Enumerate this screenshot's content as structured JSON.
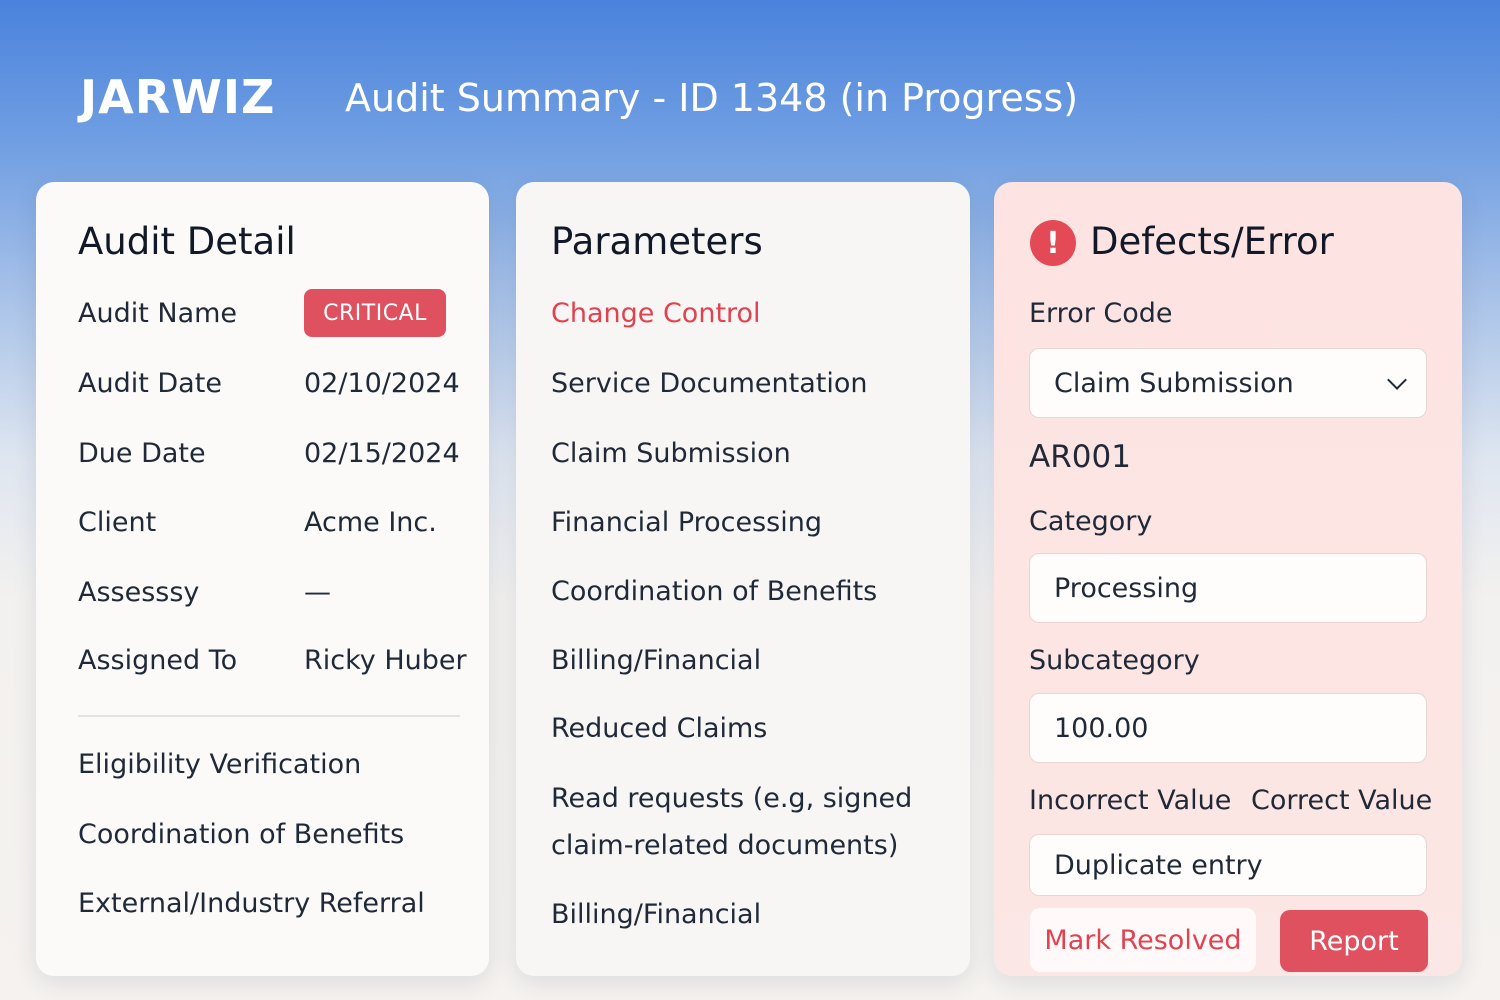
{
  "header": {
    "brand": "JARWIZ",
    "title": "Audit Summary - ID 1348 (in Progress)"
  },
  "audit_detail": {
    "title": "Audit Detail",
    "rows": [
      {
        "label": "Audit Name",
        "value": "CRITICAL"
      },
      {
        "label": "Audit Date",
        "value": "02/10/2024"
      },
      {
        "label": "Due Date",
        "value": "02/15/2024"
      },
      {
        "label": "Client",
        "value": "Acme Inc."
      },
      {
        "label": "Assesssy",
        "value": "—"
      },
      {
        "label": "Assigned To",
        "value": "Ricky Huber"
      }
    ],
    "extras": [
      "Eligibility Verification",
      "Coordination of Benefits",
      "External/Industry Referral"
    ]
  },
  "parameters": {
    "title": "Parameters",
    "items": [
      "Change Control",
      "Service Documentation",
      "Claim Submission",
      "Financial Processing",
      "Coordination of Benefits",
      "Billing/Financial",
      "Reduced Claims",
      "Read requests (e.g, signed",
      "claim-related documents)",
      "Billing/Financial"
    ],
    "active_index": 0
  },
  "defects": {
    "title": "Defects/Error",
    "icon": "alert-circle-icon",
    "error_code_label": "Error Code",
    "error_code_value": "Claim Submission",
    "code": "AR001",
    "category_label": "Category",
    "category_value": "Processing",
    "subcategory_label": "Subcategory",
    "subcategory_value": "100.00",
    "incorrect_value_label": "Incorrect Value",
    "correct_value_label": "Correct Value",
    "incorrect_value": "Duplicate entry",
    "mark_resolved_label": "Mark Resolved",
    "report_label": "Report"
  },
  "colors": {
    "accent": "#e0515f",
    "header_blue": "#4a82dc"
  }
}
